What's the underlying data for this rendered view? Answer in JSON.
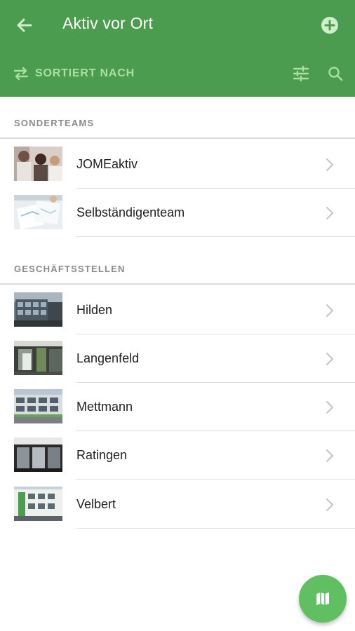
{
  "header": {
    "title": "Aktiv vor Ort",
    "back_icon": "arrow-left-icon",
    "add_icon": "plus-circle-icon",
    "sort_label": "SORTIERT NACH",
    "sort_icon": "swap-horizontal-icon",
    "filter_icon": "tune-sliders-icon",
    "search_icon": "search-icon",
    "bar_color": "#4c9c4f",
    "sort_text_color": "#a8e0a4"
  },
  "sections": [
    {
      "label": "SONDERTEAMS",
      "items": [
        {
          "label": "JOMEaktiv",
          "thumbnail": "people-photo"
        },
        {
          "label": "Selbständigenteam",
          "thumbnail": "documents-photo"
        }
      ]
    },
    {
      "label": "GESCHÄFTSSTELLEN",
      "items": [
        {
          "label": "Hilden",
          "thumbnail": "building-photo"
        },
        {
          "label": "Langenfeld",
          "thumbnail": "building-entrance-photo"
        },
        {
          "label": "Mettmann",
          "thumbnail": "building-photo"
        },
        {
          "label": "Ratingen",
          "thumbnail": "storefront-photo"
        },
        {
          "label": "Velbert",
          "thumbnail": "building-photo"
        }
      ]
    }
  ],
  "fab": {
    "icon": "map-icon",
    "color": "#5fbf61"
  }
}
